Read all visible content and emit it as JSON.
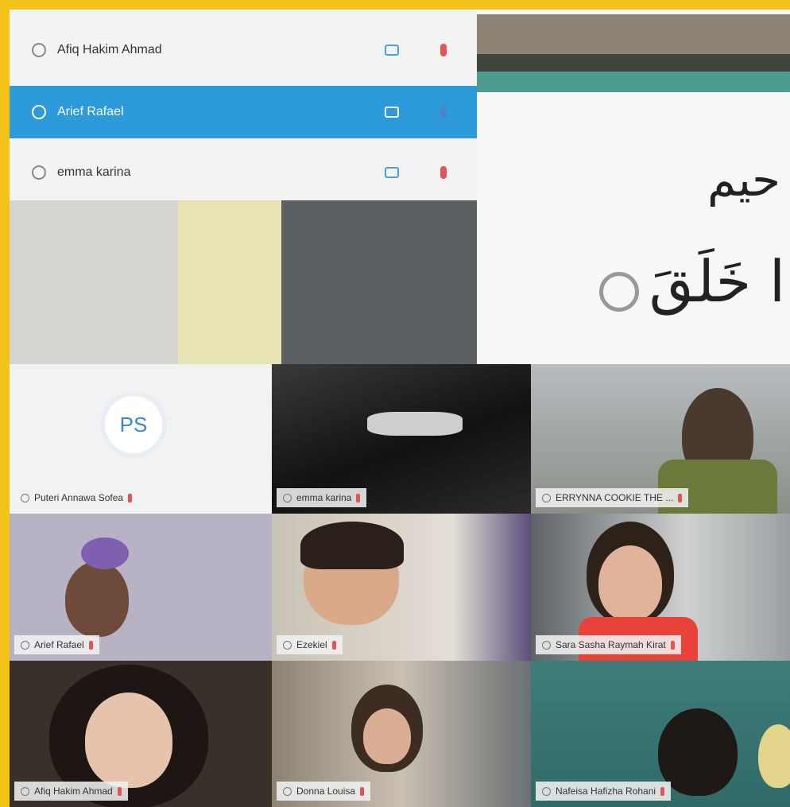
{
  "participants_panel": {
    "rows": [
      {
        "name": "Afiq Hakim Ahmad",
        "selected": false
      },
      {
        "name": "Arief Rafael",
        "selected": true
      },
      {
        "name": "emma karina",
        "selected": false
      }
    ]
  },
  "slide": {
    "line1": "حيم",
    "line2": "ا خَلَقَ"
  },
  "gallery": {
    "tiles": [
      {
        "name": "Puteri Annawa Sofea",
        "avatar_initials": "PS"
      },
      {
        "name": "emma karina"
      },
      {
        "name": "ERRYNNA COOKIE THE ..."
      },
      {
        "name": "Arief Rafael"
      },
      {
        "name": "Ezekiel"
      },
      {
        "name": "Sara Sasha Raymah Kirat"
      },
      {
        "name": "Afiq Hakim Ahmad"
      },
      {
        "name": "Donna Louisa"
      },
      {
        "name": "Nafeisa Hafizha Rohani"
      }
    ]
  },
  "colors": {
    "frame": "#f4c31a",
    "selected_row": "#2d9bd9",
    "mic_muted": "#e25555",
    "camera_icon": "#4aa3d8"
  }
}
